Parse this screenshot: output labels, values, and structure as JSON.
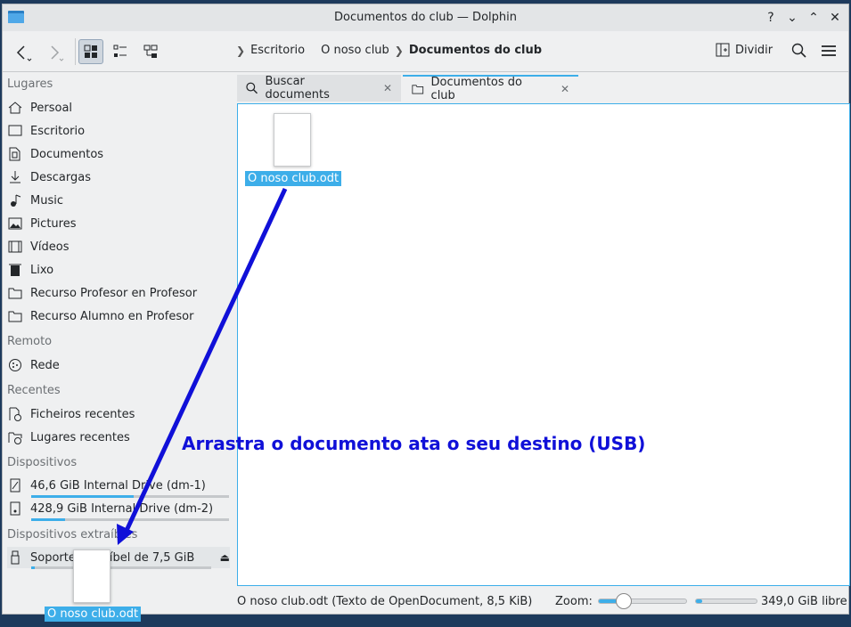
{
  "window": {
    "title": "Documentos do club — Dolphin"
  },
  "titlebar_buttons": [
    "?",
    "⌄",
    "⌃",
    "✕"
  ],
  "toolbar": {
    "breadcrumb": [
      "Escritorio",
      "O noso club",
      "Documentos do club"
    ],
    "split_label": "Dividir"
  },
  "sidebar": {
    "sections": {
      "places": "Lugares",
      "remote": "Remoto",
      "recent": "Recentes",
      "devices": "Dispositivos",
      "removable": "Dispositivos extraíbles"
    },
    "places": [
      {
        "label": "Persoal",
        "icon": "home-icon"
      },
      {
        "label": "Escritorio",
        "icon": "desktop-icon"
      },
      {
        "label": "Documentos",
        "icon": "documents-icon"
      },
      {
        "label": "Descargas",
        "icon": "download-icon"
      },
      {
        "label": "Music",
        "icon": "music-icon"
      },
      {
        "label": "Pictures",
        "icon": "pictures-icon"
      },
      {
        "label": "Vídeos",
        "icon": "videos-icon"
      },
      {
        "label": "Lixo",
        "icon": "trash-icon"
      },
      {
        "label": "Recurso Profesor en Profesor",
        "icon": "folder-icon"
      },
      {
        "label": "Recurso Alumno en Profesor",
        "icon": "folder-icon"
      }
    ],
    "remote": [
      {
        "label": "Rede",
        "icon": "network-icon"
      }
    ],
    "recent": [
      {
        "label": "Ficheiros recentes",
        "icon": "recent-files-icon"
      },
      {
        "label": "Lugares recentes",
        "icon": "recent-places-icon"
      }
    ],
    "devices": [
      {
        "label": "46,6 GiB Internal Drive (dm-1)",
        "icon": "drive-icon",
        "usage": 0.52
      },
      {
        "label": "428,9 GiB Internal Drive (dm-2)",
        "icon": "drive-icon",
        "usage": 0.17
      }
    ],
    "removable": [
      {
        "label": "Soporte extraíbel de 7,5 GiB",
        "icon": "usb-icon",
        "usage": 0.02
      }
    ]
  },
  "tabs": [
    {
      "label": "Buscar documents",
      "icon": "search-icon",
      "active": false
    },
    {
      "label": "Documentos do club",
      "icon": "folder-icon",
      "active": true
    }
  ],
  "files": [
    {
      "name": "O noso club.odt"
    }
  ],
  "status": {
    "info": "O noso club.odt (Texto de OpenDocument, 8,5 KiB)",
    "zoom_label": "Zoom:",
    "free_space": "349,0 GiB libre",
    "zoom_level": 0.2,
    "disk_usage": 0.1
  },
  "annotation": {
    "text": "Arrastra o documento ata o seu destino (USB)",
    "color": "#1010d8"
  },
  "drag_preview": {
    "name": "O noso club.odt"
  },
  "colors": {
    "accent": "#3daee9",
    "arrow": "#1010d8"
  }
}
